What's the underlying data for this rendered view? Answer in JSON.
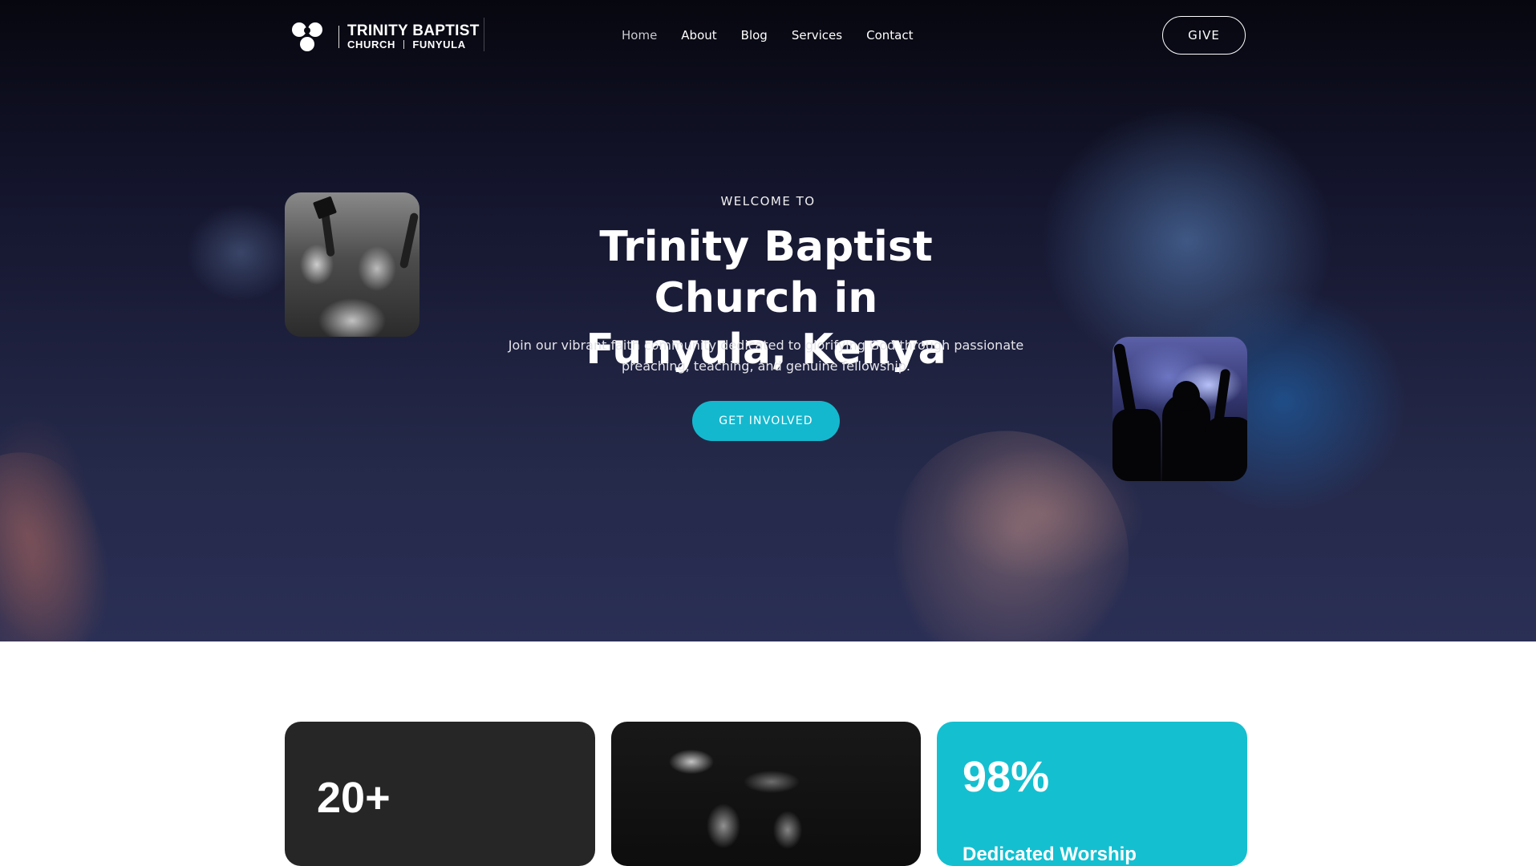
{
  "brand": {
    "name_line1": "TRINITY BAPTIST",
    "name_line2_left": "CHURCH",
    "name_line2_right": "FUNYULA"
  },
  "nav": {
    "items": [
      {
        "label": "Home",
        "active": true
      },
      {
        "label": "About"
      },
      {
        "label": "Blog"
      },
      {
        "label": "Services"
      },
      {
        "label": "Contact"
      }
    ],
    "give_label": "GIVE"
  },
  "hero": {
    "eyebrow": "WELCOME TO",
    "title_line1": "Trinity Baptist Church in",
    "title_line2": "Funyula, Kenya",
    "lead": "Join our vibrant faith community dedicated to glorifying God through passionate preaching, teaching, and genuine fellowship.",
    "cta_label": "GET INVOLVED"
  },
  "stats": [
    {
      "value": "20+"
    },
    {
      "value": "98%",
      "label": "Dedicated Worship"
    }
  ],
  "colors": {
    "accent": "#14b8ce",
    "card_dark": "#262626",
    "card_teal": "#14bfd0"
  }
}
